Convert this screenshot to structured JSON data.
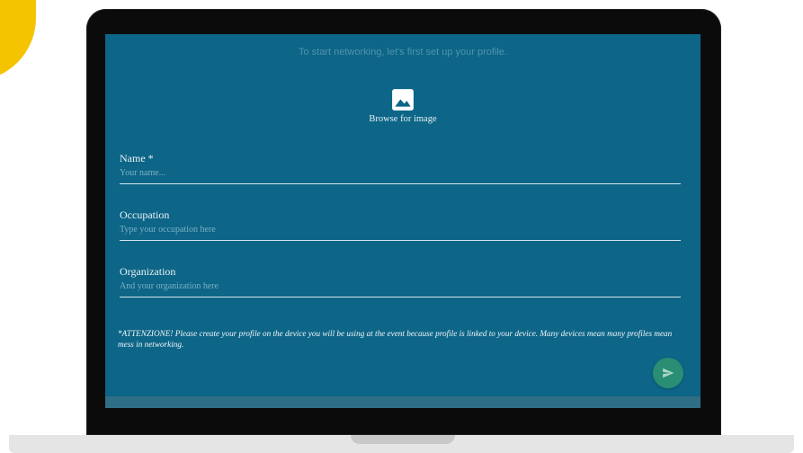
{
  "profile_form": {
    "intro": "To start networking, let's first set up your profile.",
    "image_picker": {
      "icon": "image-icon",
      "label": "Browse for image"
    },
    "fields": [
      {
        "label": "Name *",
        "placeholder": "Your name...",
        "value": ""
      },
      {
        "label": "Occupation",
        "placeholder": "Type your occupation here",
        "value": ""
      },
      {
        "label": "Organization",
        "placeholder": "And your organization here",
        "value": ""
      }
    ],
    "notice": "*ATTENZIONE! Please create your profile on the device you will be using at the event because profile is linked to your device. Many devices mean many profiles mean mess in networking.",
    "submit_button": {
      "icon": "send-icon"
    }
  },
  "colors": {
    "screen_background": "#0d6587",
    "submit_button": "#298e74",
    "accent": "#f5c400",
    "laptop_frame": "#0b0b0b",
    "laptop_base": "#e5e5e5"
  }
}
